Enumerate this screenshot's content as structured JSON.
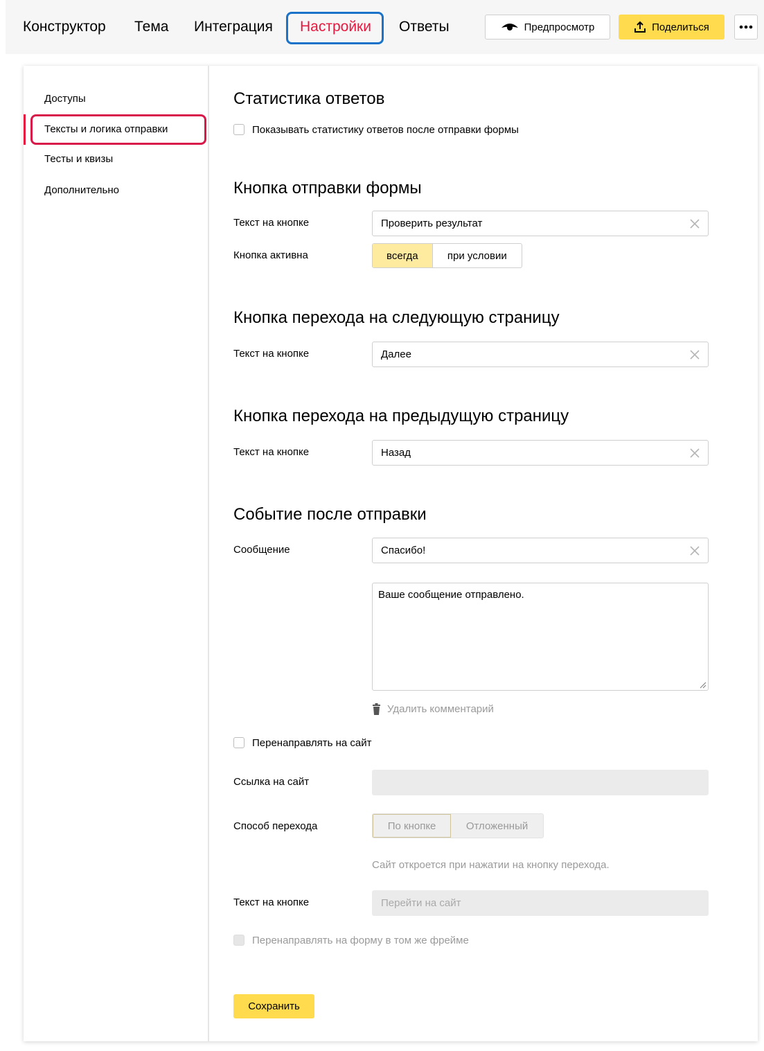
{
  "topbar": {
    "tabs": [
      {
        "label": "Конструктор"
      },
      {
        "label": "Тема"
      },
      {
        "label": "Интеграция"
      },
      {
        "label": "Настройки"
      },
      {
        "label": "Ответы"
      }
    ],
    "active_tab": "Настройки",
    "preview_label": "Предпросмотр",
    "share_label": "Поделиться",
    "more_icon": "more-dots-icon",
    "accent_color": "#e8173f",
    "highlight_color": "#1a73c8"
  },
  "sidebar": {
    "items": [
      {
        "label": "Доступы"
      },
      {
        "label": "Тексты и логика отправки"
      },
      {
        "label": "Тесты и квизы"
      },
      {
        "label": "Дополнительно"
      }
    ],
    "active_item": "Тексты и логика отправки"
  },
  "main": {
    "stats": {
      "title": "Статистика ответов",
      "checkbox_label": "Показывать статистику ответов после отправки формы",
      "checked": false
    },
    "submit_button": {
      "title": "Кнопка отправки формы",
      "text_label": "Текст на кнопке",
      "text_value": "Проверить результат",
      "active_label": "Кнопка активна",
      "active_options": [
        "всегда",
        "при условии"
      ],
      "active_selected": "всегда"
    },
    "next_button": {
      "title": "Кнопка перехода на следующую страницу",
      "text_label": "Текст на кнопке",
      "text_value": "Далее"
    },
    "prev_button": {
      "title": "Кнопка перехода на предыдущую страницу",
      "text_label": "Текст на кнопке",
      "text_value": "Назад"
    },
    "after_submit": {
      "title": "Событие после отправки",
      "message_label": "Сообщение",
      "message_value": "Спасибо!",
      "comment_value": "Ваше сообщение отправлено.",
      "delete_comment_label": "Удалить комментарий",
      "redirect_label": "Перенаправлять на сайт",
      "redirect_checked": false,
      "link_label": "Ссылка на сайт",
      "link_value": "",
      "method_label": "Способ перехода",
      "method_options": [
        "По кнопке",
        "Отложенный"
      ],
      "method_selected": "По кнопке",
      "method_hint": "Сайт откроется при нажатии на кнопку перехода.",
      "button_text_label": "Текст на кнопке",
      "button_text_placeholder": "Перейти на сайт",
      "same_frame_label": "Перенаправлять на форму в том же фрейме"
    },
    "save_label": "Сохранить"
  }
}
